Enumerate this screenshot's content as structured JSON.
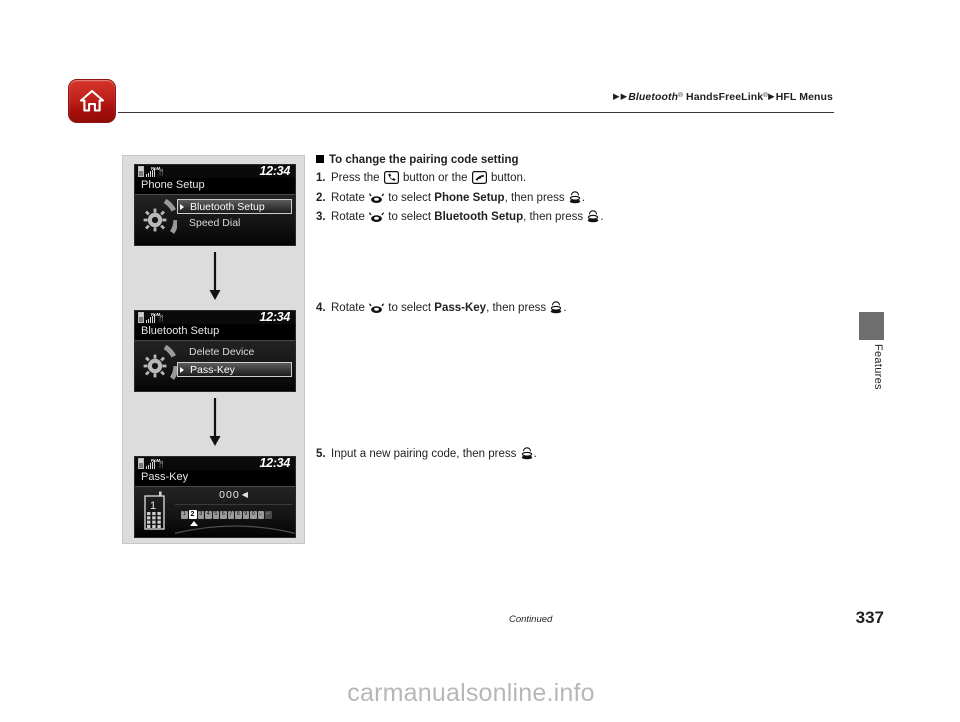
{
  "header": {
    "home_icon": "home-icon",
    "breadcrumb": {
      "tri1": "▶",
      "tri2": "▶",
      "bluetooth": "Bluetooth",
      "bluetooth_sup": "®",
      "handsfreelink": " HandsFreeLink",
      "handsfreelink_sup": "®",
      "tri3": "▶",
      "hfl_menus": "HFL Menus"
    }
  },
  "figure": {
    "screens": [
      {
        "name": "phone-setup",
        "clock": "12:34",
        "title": "Phone Setup",
        "roaming": "RoM",
        "bluetooth_icon": "ᛗ",
        "items": [
          {
            "label": "Bluetooth Setup",
            "selected": true
          },
          {
            "label": "Speed Dial",
            "selected": false
          }
        ]
      },
      {
        "name": "bluetooth-setup",
        "clock": "12:34",
        "title": "Bluetooth Setup",
        "roaming": "RoM",
        "bluetooth_icon": "ᛗ",
        "items": [
          {
            "label": "Delete Device",
            "selected": false
          },
          {
            "label": "Pass-Key",
            "selected": true
          }
        ]
      },
      {
        "name": "pass-key",
        "clock": "12:34",
        "title": "Pass-Key",
        "roaming": "RoM",
        "bluetooth_icon": "ᛗ",
        "code": "000",
        "cursor": "◀",
        "keys": [
          "1",
          "2",
          "3",
          "4",
          "5",
          "6",
          "7",
          "8",
          "9",
          "0"
        ],
        "active_key": "2",
        "backspace_label": "←",
        "return_label": "↵"
      }
    ],
    "arrow_1": "down-arrow",
    "arrow_2": "down-arrow"
  },
  "instructions": {
    "heading": "To change the pairing code setting",
    "steps": [
      {
        "num": "1.",
        "parts": [
          {
            "t": "text",
            "v": "Press the "
          },
          {
            "t": "icon",
            "v": "phone-button-icon"
          },
          {
            "t": "text",
            "v": " button or the "
          },
          {
            "t": "icon",
            "v": "hang-up-button-icon"
          },
          {
            "t": "text",
            "v": " button."
          }
        ]
      },
      {
        "num": "2.",
        "parts": [
          {
            "t": "text",
            "v": "Rotate "
          },
          {
            "t": "icon",
            "v": "rotary-knob-icon"
          },
          {
            "t": "text",
            "v": " to select "
          },
          {
            "t": "bold",
            "v": "Phone Setup"
          },
          {
            "t": "text",
            "v": ", then press "
          },
          {
            "t": "icon",
            "v": "press-knob-icon"
          },
          {
            "t": "text",
            "v": "."
          }
        ]
      },
      {
        "num": "3.",
        "parts": [
          {
            "t": "text",
            "v": "Rotate "
          },
          {
            "t": "icon",
            "v": "rotary-knob-icon"
          },
          {
            "t": "text",
            "v": " to select "
          },
          {
            "t": "bold",
            "v": "Bluetooth Setup"
          },
          {
            "t": "text",
            "v": ", then press "
          },
          {
            "t": "icon",
            "v": "press-knob-icon"
          },
          {
            "t": "text",
            "v": "."
          }
        ]
      }
    ],
    "step4": {
      "num": "4.",
      "parts": [
        {
          "t": "text",
          "v": "Rotate "
        },
        {
          "t": "icon",
          "v": "rotary-knob-icon"
        },
        {
          "t": "text",
          "v": " to select "
        },
        {
          "t": "bold",
          "v": "Pass-Key"
        },
        {
          "t": "text",
          "v": ", then press "
        },
        {
          "t": "icon",
          "v": "press-knob-icon"
        },
        {
          "t": "text",
          "v": "."
        }
      ]
    },
    "step5": {
      "num": "5.",
      "parts": [
        {
          "t": "text",
          "v": "Input a new pairing code, then press "
        },
        {
          "t": "icon",
          "v": "press-knob-icon"
        },
        {
          "t": "text",
          "v": "."
        }
      ]
    }
  },
  "side_tab": {
    "label": "Features",
    "color": "#6e6e6e"
  },
  "footer": {
    "continued": "Continued",
    "page_number": "337",
    "watermark": "carmanualsonline.info"
  }
}
